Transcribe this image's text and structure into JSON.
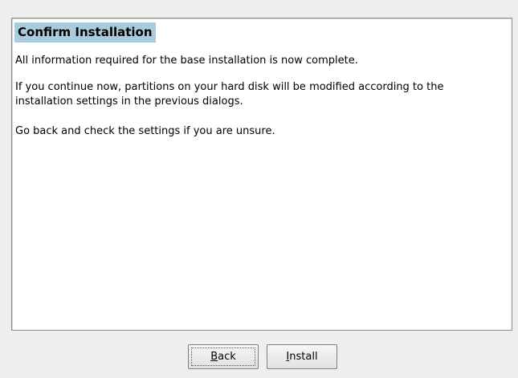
{
  "dialog": {
    "heading": "Confirm Installation",
    "paragraphs": [
      "All information required for the base installation is now complete.",
      "If you continue now, partitions on your hard disk will be modified according to the\ninstallation settings in the previous dialogs.",
      "Go back and check the settings if you are unsure."
    ]
  },
  "buttons": {
    "back": {
      "mnemonic": "B",
      "rest": "ack"
    },
    "install": {
      "mnemonic": "I",
      "rest": "nstall"
    }
  },
  "colors": {
    "heading_bg": "#a9cbdc",
    "window_bg": "#efefef",
    "panel_bg": "#ffffff"
  }
}
